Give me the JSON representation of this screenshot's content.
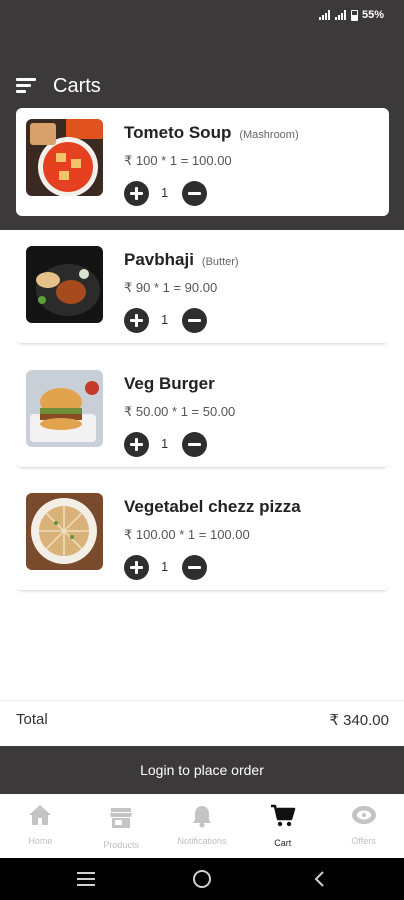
{
  "status_bar": {
    "battery": "55%"
  },
  "header": {
    "title": "Carts"
  },
  "cart_items": [
    {
      "name": "Tometo Soup",
      "variant": "(Mashroom)",
      "price_line": "₹ 100 * 1 = 100.00",
      "quantity": "1"
    },
    {
      "name": "Pavbhaji",
      "variant": "(Butter)",
      "price_line": "₹ 90 * 1 = 90.00",
      "quantity": "1"
    },
    {
      "name": "Veg Burger",
      "variant": "",
      "price_line": "₹ 50.00 * 1 = 50.00",
      "quantity": "1"
    },
    {
      "name": "Vegetabel chezz pizza",
      "variant": "",
      "price_line": "₹ 100.00 * 1 = 100.00",
      "quantity": "1"
    }
  ],
  "total": {
    "label": "Total",
    "value": "₹ 340.00"
  },
  "login_button": {
    "label": "Login to place order"
  },
  "bottom_nav": {
    "items": [
      {
        "label": "Home",
        "icon": "home-icon",
        "active": false
      },
      {
        "label": "Products",
        "icon": "store-icon",
        "active": false
      },
      {
        "label": "Notifications",
        "icon": "bell-icon",
        "active": false
      },
      {
        "label": "Cart",
        "icon": "cart-icon",
        "active": true
      },
      {
        "label": "Offers",
        "icon": "offers-icon",
        "active": false
      }
    ]
  },
  "colors": {
    "dark": "#3b3939",
    "button": "#2e2e2e",
    "inactive_nav": "#bfbfbf"
  }
}
